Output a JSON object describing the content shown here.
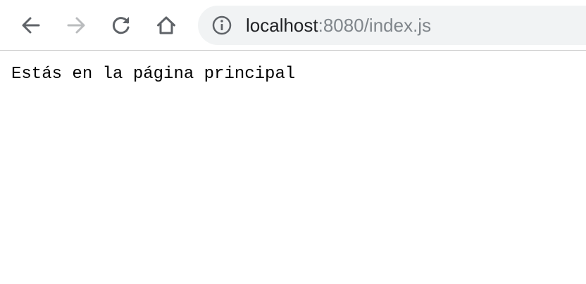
{
  "toolbar": {
    "back_icon": "arrow-left-icon",
    "forward_icon": "arrow-right-icon",
    "reload_icon": "reload-icon",
    "home_icon": "home-icon"
  },
  "address_bar": {
    "info_icon": "info-icon",
    "host": "localhost",
    "rest": ":8080/index.js",
    "colors": {
      "background": "#f1f3f4",
      "host_text": "#202124",
      "rest_text": "#80868b"
    }
  },
  "content": {
    "message": "Estás en la página principal"
  }
}
